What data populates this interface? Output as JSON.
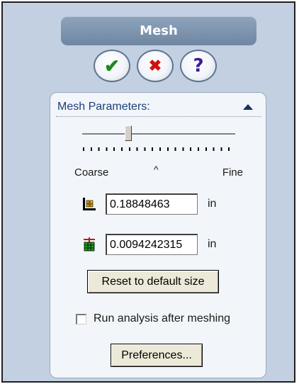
{
  "header": {
    "title": "Mesh"
  },
  "actions": {
    "ok_icon": "checkmark-icon",
    "ok_glyph": "✔",
    "cancel_icon": "cross-icon",
    "cancel_glyph": "✖",
    "help_icon": "help-icon",
    "help_glyph": "?"
  },
  "mesh_parameters": {
    "header": "Mesh Parameters:",
    "collapse_icon": "collapse-arrow-icon",
    "slider": {
      "left_label": "Coarse",
      "right_label": "Fine",
      "default_marker": "^",
      "level": 0.3,
      "tick_count": 21
    },
    "global_size": {
      "icon": "global-element-size-icon",
      "value": "0.18848463",
      "unit": "in"
    },
    "tolerance": {
      "icon": "tolerance-icon",
      "value": "0.0094242315",
      "unit": "in"
    },
    "reset_label": "Reset to default size",
    "run_analysis": {
      "label": "Run analysis after meshing",
      "checked": false
    },
    "preferences_label": "Preferences..."
  },
  "colors": {
    "panel_bg": "#c2d0e2",
    "title_bg": "#7b91ad",
    "ok_green": "#1d8a1d",
    "cancel_red": "#d01010",
    "help_purple": "#3a1a9a"
  }
}
